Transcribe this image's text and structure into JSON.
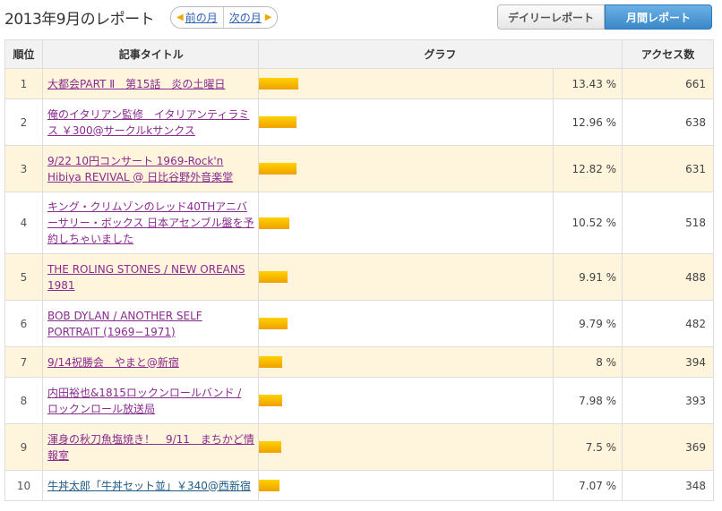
{
  "header": {
    "title": "2013年9月のレポート",
    "prev_month": "前の月",
    "next_month": "次の月",
    "daily_report": "デイリーレポート",
    "monthly_report": "月間レポート"
  },
  "table": {
    "columns": [
      "順位",
      "記事タイトル",
      "グラフ",
      "アクセス数"
    ],
    "rows": [
      {
        "rank": "1",
        "title": "大都会PART Ⅱ　第15話　炎の土曜日",
        "percent": "13.43 %",
        "share": 13.43,
        "access": "661"
      },
      {
        "rank": "2",
        "title": "俺のイタリアン監修　イタリアンティラミス ￥300@サークルkサンクス",
        "percent": "12.96 %",
        "share": 12.96,
        "access": "638"
      },
      {
        "rank": "3",
        "title": "9/22 10円コンサート 1969-Rock'n Hibiya REVIVAL @ 日比谷野外音楽堂",
        "percent": "12.82 %",
        "share": 12.82,
        "access": "631"
      },
      {
        "rank": "4",
        "title": "キング・クリムゾンのレッド40THアニバーサリー・ボックス 日本アセンブル盤を予約しちゃいました",
        "percent": "10.52 %",
        "share": 10.52,
        "access": "518"
      },
      {
        "rank": "5",
        "title": "THE ROLING STONES / NEW OREANS 1981",
        "percent": "9.91 %",
        "share": 9.91,
        "access": "488"
      },
      {
        "rank": "6",
        "title": "BOB DYLAN / ANOTHER SELF PORTRAIT (1969−1971)",
        "percent": "9.79 %",
        "share": 9.79,
        "access": "482"
      },
      {
        "rank": "7",
        "title": "9/14祝勝会　やまと@新宿",
        "percent": "8 %",
        "share": 8,
        "access": "394"
      },
      {
        "rank": "8",
        "title": "内田裕也&1815ロックンロールバンド / ロックンロール放送局",
        "percent": "7.98 %",
        "share": 7.98,
        "access": "393"
      },
      {
        "rank": "9",
        "title": "渾身の秋刀魚塩焼き！　9/11　まちかど情報室",
        "percent": "7.5 %",
        "share": 7.5,
        "access": "369"
      },
      {
        "rank": "10",
        "title": "牛丼太郎「牛丼セット並」￥340@西新宿",
        "percent": "7.07 %",
        "share": 7.07,
        "access": "348"
      }
    ]
  },
  "colors": {
    "bar": "#f5b400",
    "odd_row": "#fff4dc",
    "active_toggle": "#4a94d4",
    "link": "#8a2b8f",
    "link_visited": "#1f5a85"
  }
}
